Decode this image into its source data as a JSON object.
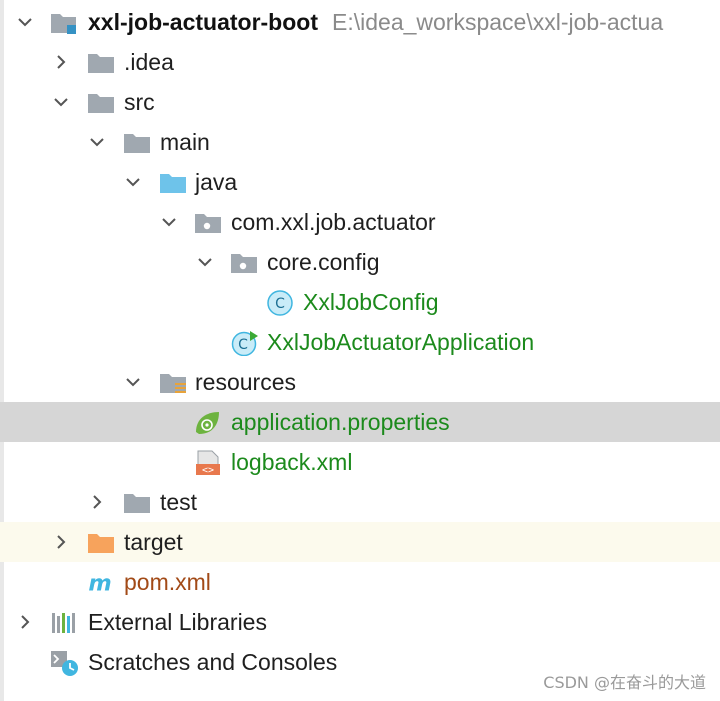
{
  "project": {
    "name": "xxl-job-actuator-boot",
    "path": "E:\\idea_workspace\\xxl-job-actua"
  },
  "tree": {
    "idea": ".idea",
    "src": "src",
    "main": "main",
    "java": "java",
    "package": "com.xxl.job.actuator",
    "core_config": "core.config",
    "xxl_job_config": "XxlJobConfig",
    "application_class": "XxlJobActuatorApplication",
    "resources": "resources",
    "app_properties": "application.properties",
    "logback": "logback.xml",
    "test": "test",
    "target": "target",
    "pom": "pom.xml",
    "external_libraries": "External Libraries",
    "scratches": "Scratches and Consoles"
  },
  "icons": {
    "chevron_down": "chevron-down-icon",
    "chevron_right": "chevron-right-icon",
    "folder": "folder-icon",
    "source_folder": "source-folder-icon",
    "package": "package-icon",
    "class": "class-icon",
    "spring_class": "spring-boot-class-icon",
    "resources_folder": "resources-folder-icon",
    "spring_properties": "spring-properties-icon",
    "xml": "xml-file-icon",
    "excluded_folder": "excluded-folder-icon",
    "maven": "maven-icon",
    "libraries": "libraries-icon",
    "scratches": "scratches-icon"
  },
  "colors": {
    "selection": "#d6d6d6",
    "highlight": "#fcfaed",
    "green_text": "#1c8a1c",
    "pom_text": "#a24a17",
    "folder_gray": "#a0a8b0",
    "java_folder_blue": "#6ec3ea",
    "target_orange": "#f7a35c",
    "class_cyan": "#40b6e0"
  },
  "watermark": "CSDN @在奋斗的大道"
}
